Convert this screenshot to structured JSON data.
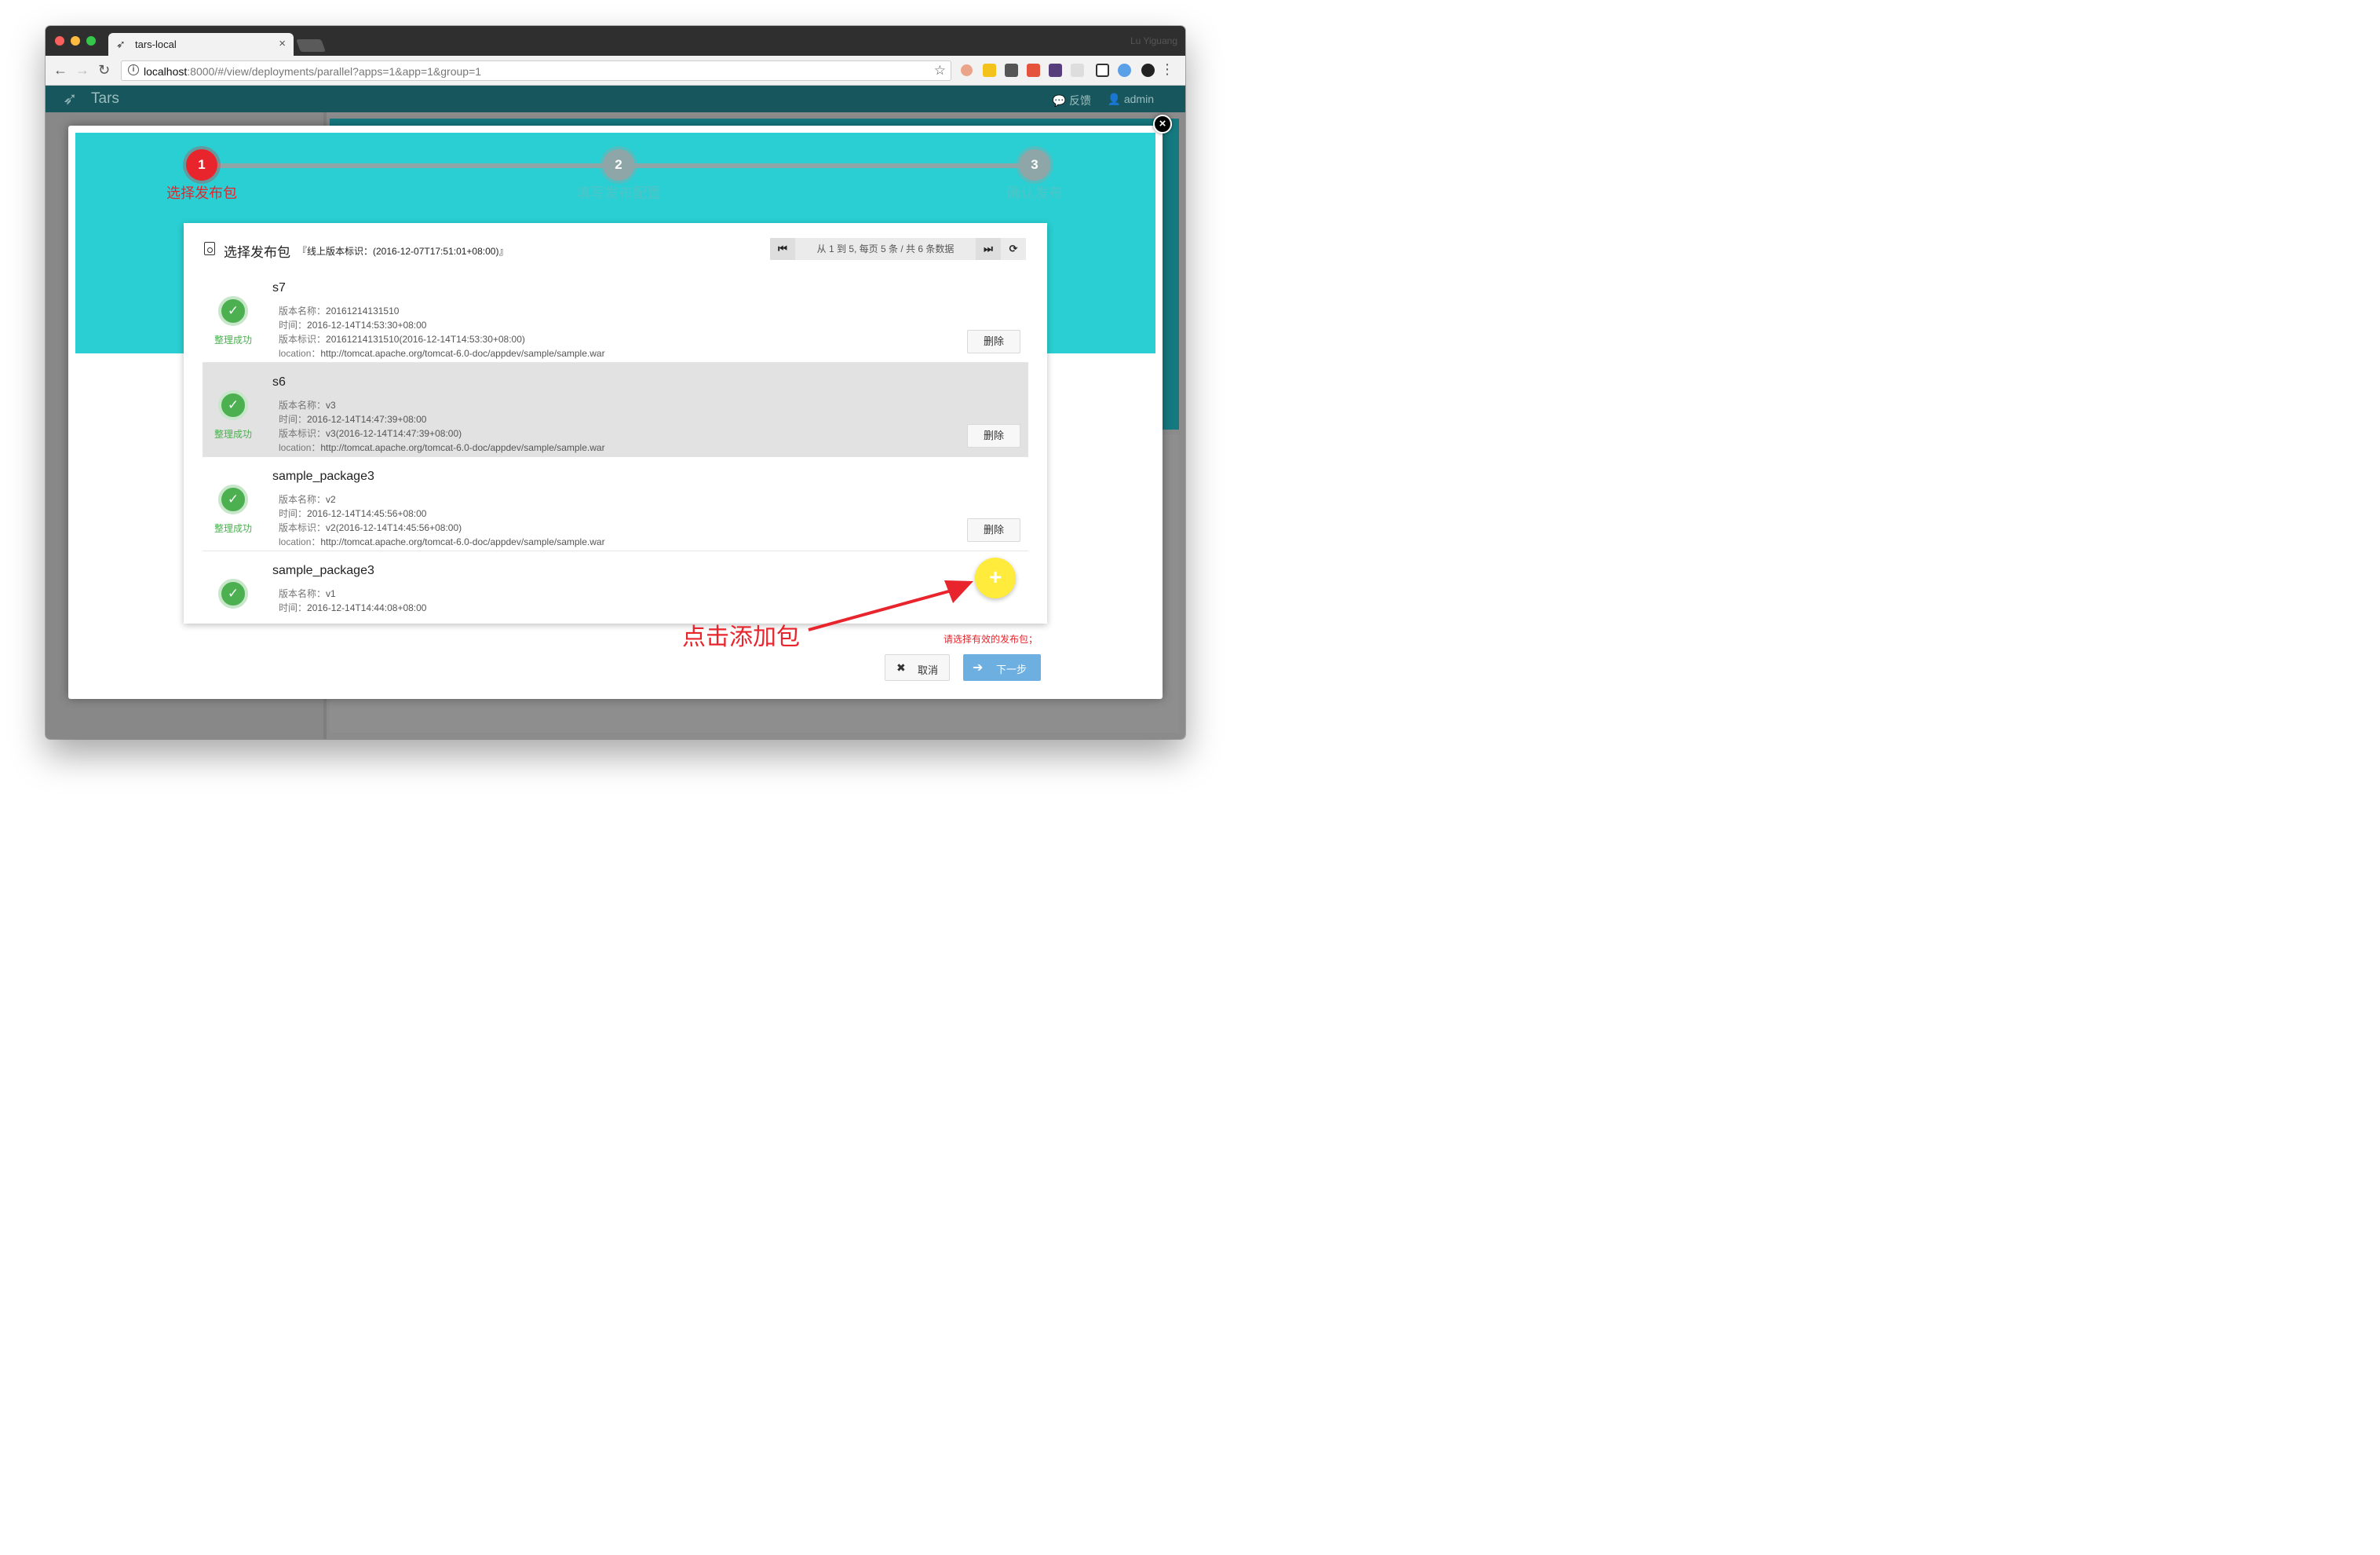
{
  "browser": {
    "tab_title": "tars-local",
    "tab_close": "×",
    "url_host": "localhost",
    "url_rest": ":8000/#/view/deployments/parallel?apps=1&app=1&group=1",
    "user_name": "Lu Yiguang"
  },
  "app": {
    "logo": "Tars",
    "feedback": "反馈",
    "user": "admin"
  },
  "steps": [
    {
      "number": "1",
      "label": "选择发布包",
      "state": "active"
    },
    {
      "number": "2",
      "label": "填写发布配置",
      "state": "inactive"
    },
    {
      "number": "3",
      "label": "确认发布",
      "state": "inactive"
    }
  ],
  "card": {
    "title": "选择发布包",
    "subtitle": "『线上版本标识：(2016-12-07T17:51:01+08:00)』",
    "pager": {
      "first": "⏮",
      "text": "从 1 到 5, 每页 5 条 / 共 6 条数据",
      "last": "⏭",
      "refresh": "⟳"
    },
    "packages": [
      {
        "name": "s7",
        "status": "整理成功",
        "version_name_label": "版本名称：",
        "version_name": "20161214131510",
        "time_label": "时间：",
        "time": "2016-12-14T14:53:30+08:00",
        "tag_label": "版本标识：",
        "tag": "20161214131510(2016-12-14T14:53:30+08:00)",
        "location_label": "location：",
        "location": "http://tomcat.apache.org/tomcat-6.0-doc/appdev/sample/sample.war",
        "delete": "删除"
      },
      {
        "name": "s6",
        "status": "整理成功",
        "version_name_label": "版本名称：",
        "version_name": "v3",
        "time_label": "时间：",
        "time": "2016-12-14T14:47:39+08:00",
        "tag_label": "版本标识：",
        "tag": "v3(2016-12-14T14:47:39+08:00)",
        "location_label": "location：",
        "location": "http://tomcat.apache.org/tomcat-6.0-doc/appdev/sample/sample.war",
        "delete": "删除"
      },
      {
        "name": "sample_package3",
        "status": "整理成功",
        "version_name_label": "版本名称：",
        "version_name": "v2",
        "time_label": "时间：",
        "time": "2016-12-14T14:45:56+08:00",
        "tag_label": "版本标识：",
        "tag": "v2(2016-12-14T14:45:56+08:00)",
        "location_label": "location：",
        "location": "http://tomcat.apache.org/tomcat-6.0-doc/appdev/sample/sample.war",
        "delete": "删除"
      },
      {
        "name": "sample_package3",
        "version_name_label": "版本名称：",
        "version_name": "v1",
        "time_label": "时间：",
        "time": "2016-12-14T14:44:08+08:00"
      }
    ]
  },
  "add_button": "+",
  "annotation": "点击添加包",
  "warning": "请选择有效的发布包；",
  "footer": {
    "cancel": "取消",
    "next": "下一步"
  },
  "colors": {
    "banner": "#29cfd2",
    "active_step": "#e8242c",
    "success": "#4caf50",
    "add_button": "#ffeb3b",
    "next_button": "#6dafe0",
    "app_header": "#17565c"
  }
}
